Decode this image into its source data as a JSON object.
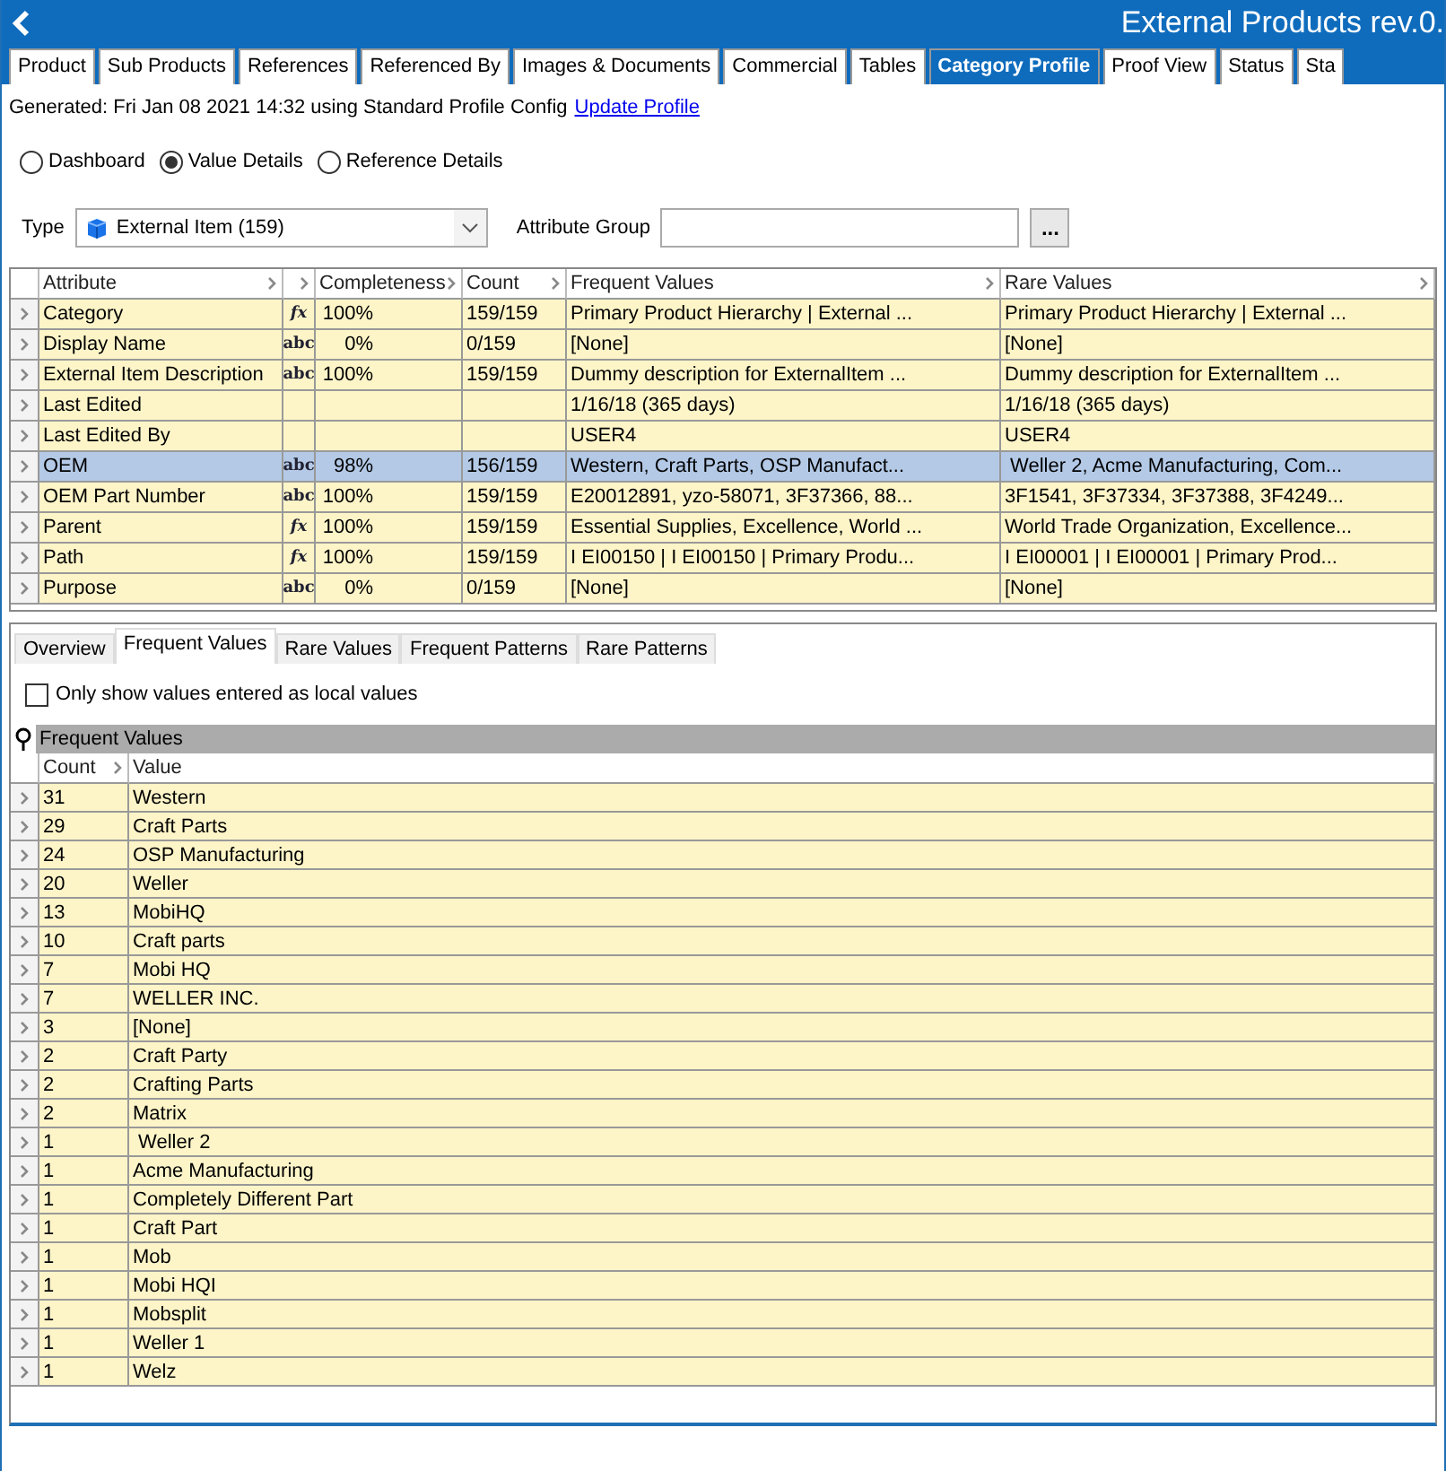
{
  "window": {
    "title": "External Products rev.0."
  },
  "tabs": [
    {
      "label": "Product",
      "selected": false
    },
    {
      "label": "Sub Products",
      "selected": false
    },
    {
      "label": "References",
      "selected": false
    },
    {
      "label": "Referenced By",
      "selected": false
    },
    {
      "label": "Images & Documents",
      "selected": false
    },
    {
      "label": "Commercial",
      "selected": false
    },
    {
      "label": "Tables",
      "selected": false
    },
    {
      "label": "Category Profile",
      "selected": true
    },
    {
      "label": "Proof View",
      "selected": false
    },
    {
      "label": "Status",
      "selected": false
    },
    {
      "label": "Sta",
      "selected": false
    }
  ],
  "generated": {
    "text": "Generated: Fri Jan 08 2021 14:32 using Standard Profile Config",
    "link": "Update Profile"
  },
  "views": [
    {
      "label": "Dashboard",
      "selected": false
    },
    {
      "label": "Value Details",
      "selected": true
    },
    {
      "label": "Reference Details",
      "selected": false
    }
  ],
  "type_field": {
    "label": "Type",
    "value": "External Item (159)"
  },
  "attribute_group": {
    "label": "Attribute Group",
    "button": "..."
  },
  "attributes_table": {
    "columns": [
      "Attribute",
      "Completeness",
      "Count",
      "Frequent Values",
      "Rare Values"
    ],
    "rows": [
      {
        "attribute": "Category",
        "type": "fx",
        "completeness": "100%",
        "count": "159/159",
        "frequent": "Primary Product Hierarchy | External ...",
        "rare": "Primary Product Hierarchy | External ...",
        "selected": false
      },
      {
        "attribute": "Display Name",
        "type": "abc",
        "completeness": "0%",
        "count": "0/159",
        "frequent": "[None]",
        "rare": "[None]",
        "selected": false
      },
      {
        "attribute": "External Item Description",
        "type": "abc",
        "completeness": "100%",
        "count": "159/159",
        "frequent": "Dummy description for ExternalItem ...",
        "rare": "Dummy description for ExternalItem ...",
        "selected": false
      },
      {
        "attribute": "Last Edited",
        "frequent": "1/16/18 (365 days)",
        "rare": "1/16/18 (365 days)",
        "selected": false
      },
      {
        "attribute": "Last Edited By",
        "frequent": "USER4",
        "rare": "USER4",
        "selected": false
      },
      {
        "attribute": "OEM",
        "type": "abc",
        "completeness": "98%",
        "count": "156/159",
        "frequent": "Western, Craft Parts, OSP Manufact...",
        "rare": " Weller 2, Acme Manufacturing, Com...",
        "selected": true
      },
      {
        "attribute": "OEM Part Number",
        "type": "abc",
        "completeness": "100%",
        "count": "159/159",
        "frequent": "E20012891, yzo-58071, 3F37366, 88...",
        "rare": "3F1541, 3F37334, 3F37388, 3F4249...",
        "selected": false
      },
      {
        "attribute": "Parent",
        "type": "fx",
        "completeness": "100%",
        "count": "159/159",
        "frequent": "Essential Supplies, Excellence, World ...",
        "rare": "World Trade Organization, Excellence...",
        "selected": false
      },
      {
        "attribute": "Path",
        "type": "fx",
        "completeness": "100%",
        "count": "159/159",
        "frequent": "I EI00150 | I EI00150 | Primary Produ...",
        "rare": "I EI00001 | I EI00001 | Primary Prod...",
        "selected": false
      },
      {
        "attribute": "Purpose",
        "type": "abc",
        "completeness": "0%",
        "count": "0/159",
        "frequent": "[None]",
        "rare": "[None]",
        "selected": false
      }
    ]
  },
  "detail_tabs": [
    {
      "label": "Overview",
      "selected": false
    },
    {
      "label": "Frequent Values",
      "selected": true
    },
    {
      "label": "Rare Values",
      "selected": false
    },
    {
      "label": "Frequent Patterns",
      "selected": false
    },
    {
      "label": "Rare Patterns",
      "selected": false
    }
  ],
  "local_values_checkbox": {
    "label": "Only show values entered as local values",
    "checked": false
  },
  "frequent_values": {
    "title": "Frequent Values",
    "columns": [
      "Count",
      "Value"
    ],
    "rows": [
      {
        "count": "31",
        "value": "Western"
      },
      {
        "count": "29",
        "value": "Craft Parts"
      },
      {
        "count": "24",
        "value": "OSP Manufacturing"
      },
      {
        "count": "20",
        "value": "Weller"
      },
      {
        "count": "13",
        "value": "MobiHQ"
      },
      {
        "count": "10",
        "value": "Craft parts"
      },
      {
        "count": "7",
        "value": "Mobi HQ"
      },
      {
        "count": "7",
        "value": "WELLER INC."
      },
      {
        "count": "3",
        "value": "[None]"
      },
      {
        "count": "2",
        "value": "Craft Party"
      },
      {
        "count": "2",
        "value": "Crafting Parts"
      },
      {
        "count": "2",
        "value": "Matrix"
      },
      {
        "count": "1",
        "value": " Weller 2"
      },
      {
        "count": "1",
        "value": "Acme Manufacturing"
      },
      {
        "count": "1",
        "value": "Completely Different Part"
      },
      {
        "count": "1",
        "value": "Craft Part"
      },
      {
        "count": "1",
        "value": "Mob"
      },
      {
        "count": "1",
        "value": "Mobi HQI"
      },
      {
        "count": "1",
        "value": "Mobsplit"
      },
      {
        "count": "1",
        "value": "Weller 1"
      },
      {
        "count": "1",
        "value": "Welz"
      }
    ]
  }
}
